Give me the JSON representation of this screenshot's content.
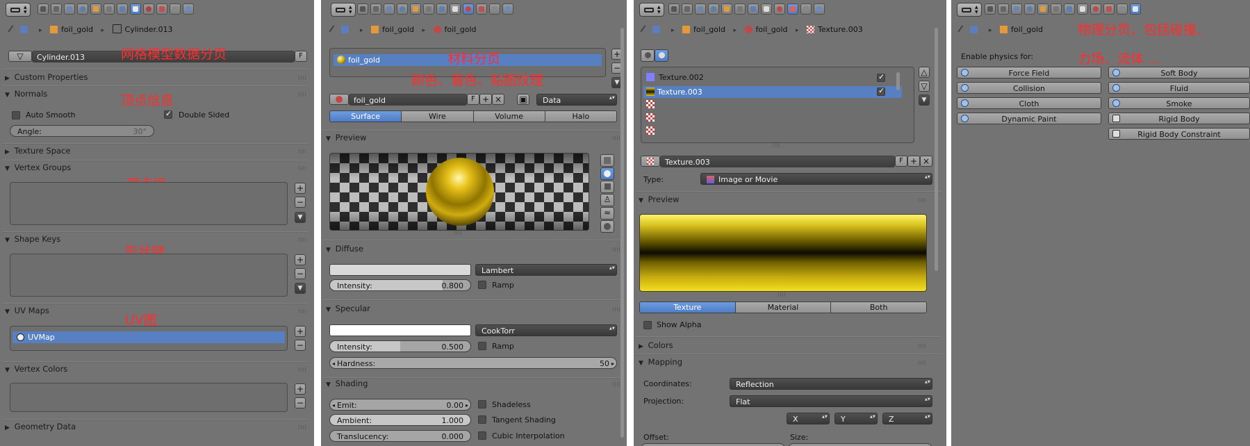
{
  "panels": {
    "mesh": {
      "breadcrumb": [
        "foil_gold",
        "Cylinder.013"
      ],
      "datablock_name": "Cylinder.013",
      "fake_user_label": "F",
      "annotation_title": "网格模型数据分页",
      "annotation_normals": "顶点信息",
      "annotation_vgroups": "顶点组",
      "annotation_shapekeys": "形状键",
      "annotation_uv": "UV图",
      "sections": {
        "custom_properties": "Custom Properties",
        "normals": "Normals",
        "texture_space": "Texture Space",
        "vertex_groups": "Vertex Groups",
        "shape_keys": "Shape Keys",
        "uv_maps": "UV Maps",
        "vertex_colors": "Vertex Colors",
        "geometry_data": "Geometry Data"
      },
      "auto_smooth_label": "Auto Smooth",
      "double_sided_label": "Double Sided",
      "angle_label": "Angle:",
      "angle_value": "30°",
      "uv_map_item": "UVMap"
    },
    "material": {
      "breadcrumb": [
        "foil_gold",
        "foil_gold"
      ],
      "slot_item": "foil_gold",
      "annotation_title": "材料分页",
      "annotation_sub": "颜色、着色、贴图纹理",
      "material_name": "foil_gold",
      "fake_user_label": "F",
      "link_value": "Data",
      "tabs": [
        "Surface",
        "Wire",
        "Volume",
        "Halo"
      ],
      "active_tab": "Surface",
      "sections": {
        "preview": "Preview",
        "diffuse": "Diffuse",
        "specular": "Specular",
        "shading": "Shading"
      },
      "diffuse_shader": "Lambert",
      "diffuse_intensity_label": "Intensity:",
      "diffuse_intensity": "0.800",
      "diffuse_intensity_fraction": 0.8,
      "ramp_label": "Ramp",
      "specular_shader": "CookTorr",
      "specular_intensity_label": "Intensity:",
      "specular_intensity": "0.500",
      "specular_intensity_fraction": 0.5,
      "hardness_label": "Hardness:",
      "hardness_value": "50",
      "emit_label": "Emit:",
      "emit_value": "0.00",
      "ambient_label": "Ambient:",
      "ambient_value": "1.000",
      "translucency_label": "Translucency:",
      "translucency_value": "0.000",
      "shadeless_label": "Shadeless",
      "tangent_label": "Tangent Shading",
      "cubic_label": "Cubic Interpolation",
      "colors": {
        "diffuse": "#d9d9d9",
        "specular": "#ffffff",
        "gold": "#e8c21a"
      }
    },
    "texture": {
      "breadcrumb": [
        "foil_gold",
        "foil_gold",
        "Texture.003"
      ],
      "slots": [
        "Texture.002",
        "Texture.003",
        "",
        "",
        ""
      ],
      "active_slot": "Texture.003",
      "texture_name": "Texture.003",
      "fake_user_label": "F",
      "type_label": "Type:",
      "type_value": "Image or Movie",
      "sections": {
        "preview": "Preview",
        "colors": "Colors",
        "mapping": "Mapping"
      },
      "preview_tabs": [
        "Texture",
        "Material",
        "Both"
      ],
      "active_preview_tab": "Texture",
      "show_alpha_label": "Show Alpha",
      "coordinates_label": "Coordinates:",
      "coordinates_value": "Reflection",
      "projection_label": "Projection:",
      "projection_value": "Flat",
      "axes": [
        "X",
        "Y",
        "Z"
      ],
      "offset_label": "Offset:",
      "size_label": "Size:"
    },
    "physics": {
      "breadcrumb": [
        "foil_gold"
      ],
      "annotation_line1": "物理分页，包括碰撞、",
      "annotation_line2": "力场、流体 ...",
      "enable_label": "Enable physics for:",
      "buttons_left": [
        "Force Field",
        "Collision",
        "Cloth",
        "Dynamic Paint"
      ],
      "buttons_right": [
        "Soft Body",
        "Fluid",
        "Smoke",
        "Rigid Body",
        "Rigid Body Constraint"
      ]
    }
  }
}
